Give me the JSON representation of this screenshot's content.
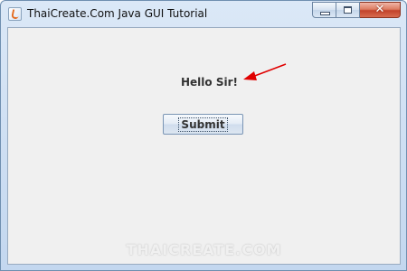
{
  "window": {
    "title": "ThaiCreate.Com Java GUI Tutorial",
    "icon": "java-icon",
    "controls": {
      "minimize_icon": "minimize-icon",
      "maximize_icon": "maximize-icon",
      "close_icon": "close-icon",
      "close_glyph": "✕"
    }
  },
  "content": {
    "label_text": "Hello Sir!",
    "button_label": "Submit",
    "watermark": "THAICREATE.COM"
  },
  "annotation": {
    "arrow_color": "#e00000"
  },
  "colors": {
    "client_background": "#f0f0f0",
    "close_button": "#c9472d",
    "title_bar": "#cfe0f3"
  }
}
